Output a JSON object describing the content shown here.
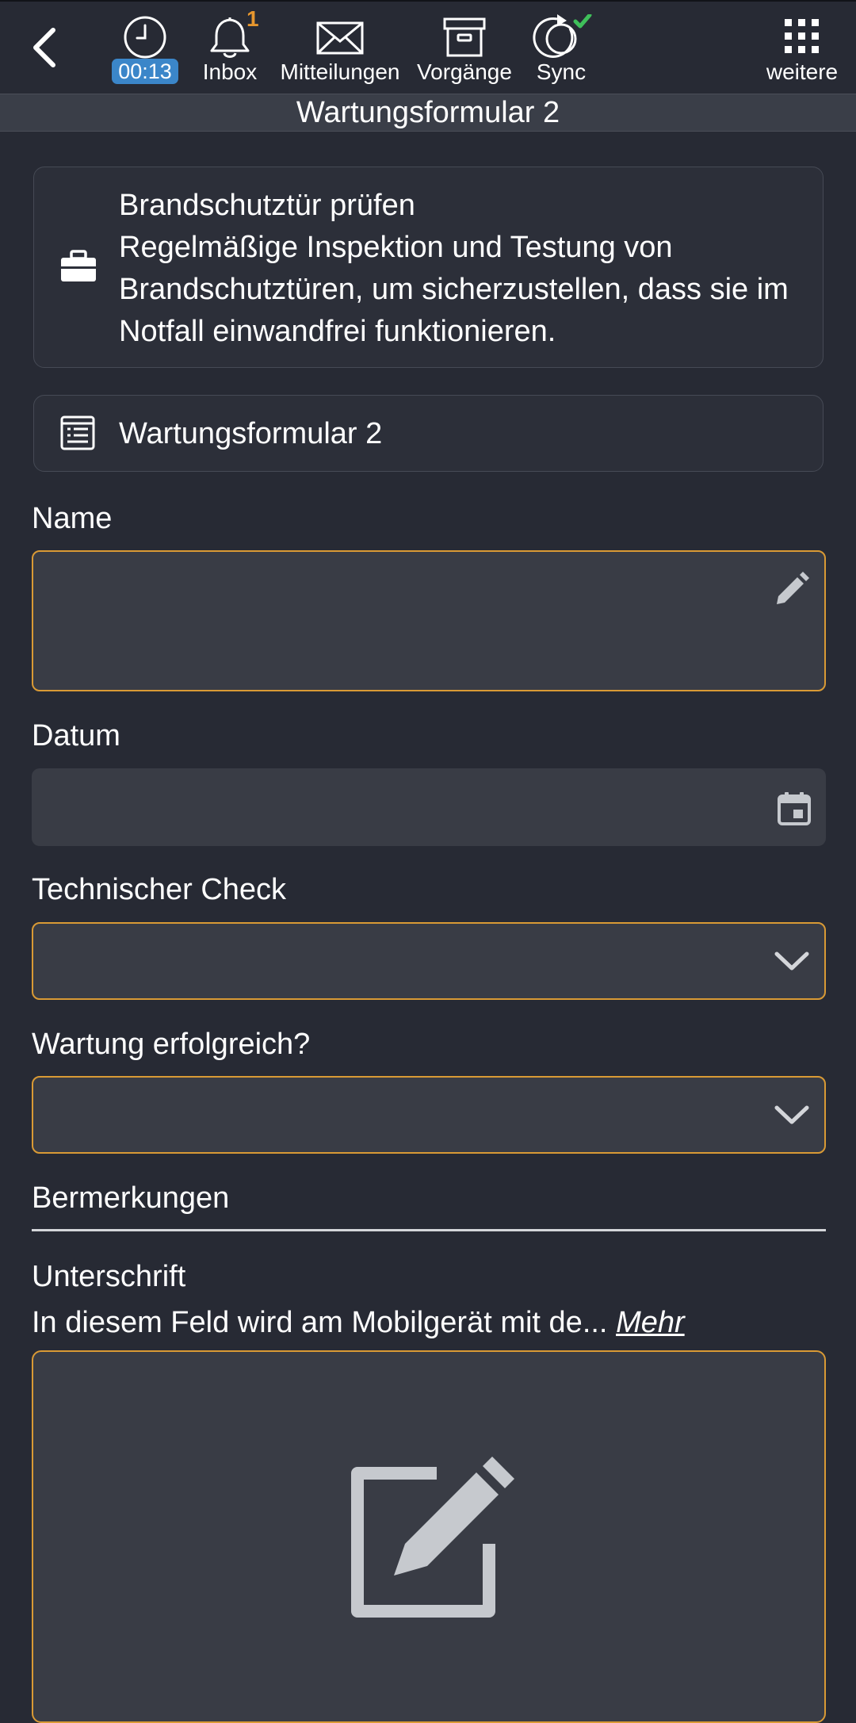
{
  "toolbar": {
    "timer": "00:13",
    "inbox_label": "Inbox",
    "inbox_count": "1",
    "messages_label": "Mitteilungen",
    "processes_label": "Vorgänge",
    "sync_label": "Sync",
    "more_label": "weitere"
  },
  "title": "Wartungsformular 2",
  "task_card": {
    "title": "Brandschutztür prüfen",
    "description": "Regelmäßige Inspektion und Testung von Brandschutztüren, um sicherzustellen, dass sie im Notfall einwandfrei funktionieren."
  },
  "form_card": {
    "name": "Wartungsformular 2"
  },
  "form": {
    "name_label": "Name",
    "name_value": "",
    "date_label": "Datum",
    "date_value": "",
    "tech_check_label": "Technischer Check",
    "tech_check_value": "",
    "maintenance_success_label": "Wartung erfolgreich?",
    "maintenance_success_value": "",
    "remarks_label": "Bermerkungen",
    "signature_label": "Unterschrift",
    "signature_hint": "In diesem Feld wird am Mobilgerät mit de...",
    "signature_more": "Mehr"
  },
  "colors": {
    "background": "#272a34",
    "field_background": "#393c45",
    "required_border": "#d99a35",
    "timer_badge": "#3b86c9",
    "inbox_count": "#e6962e",
    "sync_check": "#3fbf5a"
  }
}
